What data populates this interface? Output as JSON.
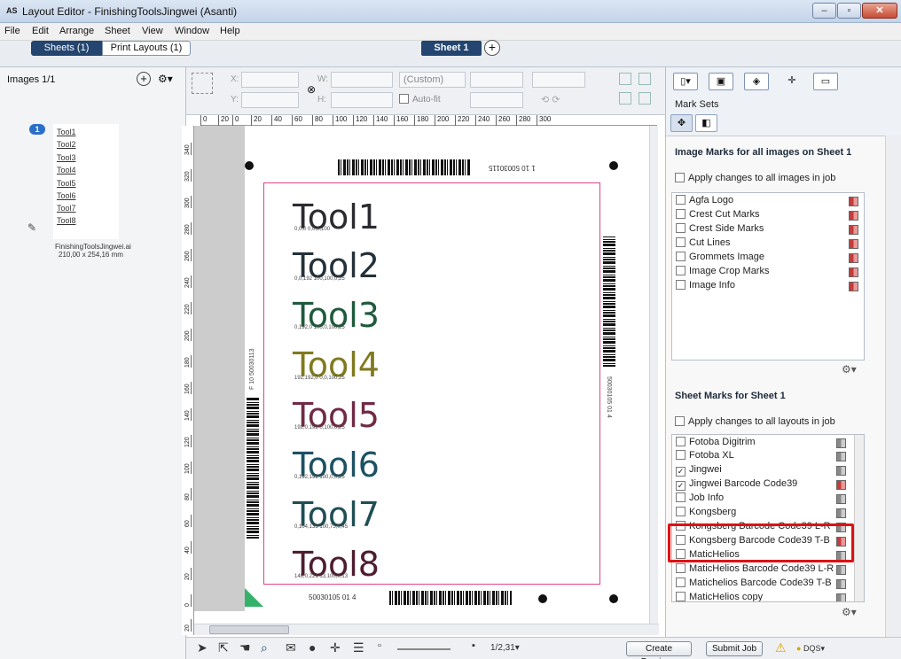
{
  "window": {
    "title": "Layout Editor - FinishingToolsJingwei (Asanti)",
    "logo": "AS",
    "min": "–",
    "max": "▫",
    "close": "✕"
  },
  "menu": [
    "File",
    "Edit",
    "Arrange",
    "Sheet",
    "View",
    "Window",
    "Help"
  ],
  "tabs": {
    "sheets": "Sheets (1)",
    "print_layouts": "Print Layouts (1)",
    "sheet1": "Sheet 1",
    "add": "+"
  },
  "left": {
    "images_label": "Images 1/1",
    "badge": "1",
    "thumb_lines": [
      "Tool1",
      "Tool2",
      "Tool3",
      "Tool4",
      "Tool5",
      "Tool6",
      "Tool7",
      "Tool8"
    ],
    "file_name": "FinishingToolsJingwei.ai",
    "file_size": "210,00 x 254,16 mm"
  },
  "toolbar": {
    "x_label": "X:",
    "y_label": "Y:",
    "w_label": "W:",
    "h_label": "H:",
    "preset": "(Custom)",
    "autofit": "Auto-fit"
  },
  "right": {
    "mark_sets_label": "Mark Sets",
    "image_marks_title": "Image Marks for all images on Sheet 1",
    "image_apply": "Apply changes to all images in job",
    "image_marks": [
      "Agfa Logo",
      "Crest Cut Marks",
      "Crest Side Marks",
      "Cut Lines",
      "Grommets Image",
      "Image Crop Marks",
      "Image Info"
    ],
    "sheet_marks_title": "Sheet Marks for Sheet 1",
    "sheet_apply": "Apply changes to all layouts in job",
    "sheet_marks": [
      {
        "label": "Fotoba Digitrim",
        "checked": false
      },
      {
        "label": "Fotoba XL",
        "checked": false
      },
      {
        "label": "Jingwei",
        "checked": true
      },
      {
        "label": "Jingwei Barcode Code39",
        "checked": true
      },
      {
        "label": "Job Info",
        "checked": false
      },
      {
        "label": "Kongsberg",
        "checked": false
      },
      {
        "label": "Kongsberg Barcode Code39 L-R",
        "checked": false
      },
      {
        "label": "Kongsberg Barcode Code39 T-B",
        "checked": false
      },
      {
        "label": "MaticHelios",
        "checked": false
      },
      {
        "label": "MaticHelios Barcode Code39 L-R",
        "checked": false
      },
      {
        "label": "Matichelios Barcode Code39 T-B",
        "checked": false
      },
      {
        "label": "MaticHelios copy",
        "checked": false
      }
    ]
  },
  "ruler_top": [
    "0",
    "20",
    "0",
    "20",
    "40",
    "60",
    "80",
    "100",
    "120",
    "140",
    "160",
    "180",
    "200",
    "220",
    "240",
    "260",
    "280",
    "300"
  ],
  "ruler_left": [
    "340",
    "320",
    "300",
    "280",
    "260",
    "240",
    "220",
    "200",
    "180",
    "160",
    "140",
    "120",
    "100",
    "80",
    "60",
    "40",
    "20",
    "0",
    "20"
  ],
  "tools": [
    {
      "name": "Tool1",
      "color": "#2b2b30",
      "sub": "0,0,0          0,0,0,100"
    },
    {
      "name": "Tool2",
      "color": "#24313a",
      "sub": "0,0,192      100,100,0,25"
    },
    {
      "name": "Tool3",
      "color": "#1f5a3c",
      "sub": "0,192,0      100,0,100,25"
    },
    {
      "name": "Tool4",
      "color": "#7f7a1f",
      "sub": "192,192,0    0,0,100,25"
    },
    {
      "name": "Tool5",
      "color": "#702a46",
      "sub": "192,0,192    0,100,0,25"
    },
    {
      "name": "Tool6",
      "color": "#1c5262",
      "sub": "0,192,192    100,0,0,25"
    },
    {
      "name": "Tool7",
      "color": "#1f4e55",
      "sub": "0,104,135    100,75,0,45"
    },
    {
      "name": "Tool8",
      "color": "#4e1d31",
      "sub": "148,0,221    33,100,0,13"
    }
  ],
  "sheet_texts": {
    "top": "1 10 50030115",
    "left": "F 10 50030113",
    "right": "50030105 01 4",
    "bottom": "50030105 01 4"
  },
  "bottom": {
    "zoom": "1/2,31▾",
    "create_previews": "Create Previews",
    "submit_job": "Submit Job",
    "dqs": "DQS▾",
    "warn": "⚠"
  }
}
